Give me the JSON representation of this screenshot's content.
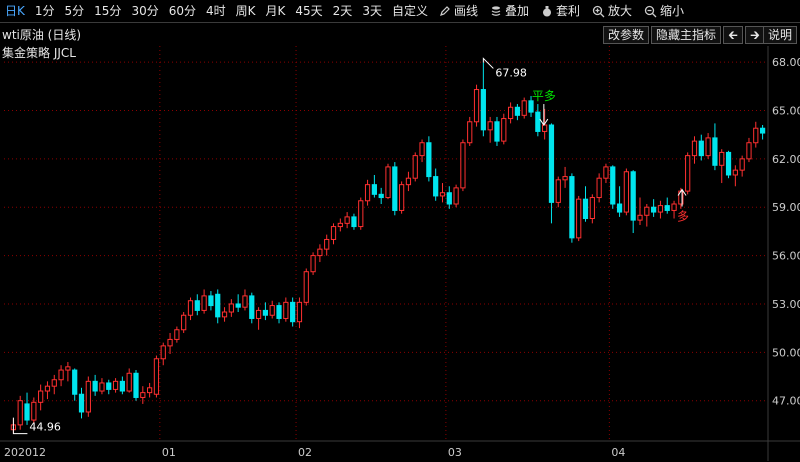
{
  "toolbar": {
    "periods": [
      "日K",
      "1分",
      "5分",
      "15分",
      "30分",
      "60分",
      "4时",
      "周K",
      "月K",
      "45天",
      "2天",
      "3天",
      "自定义"
    ],
    "active_period": "日K",
    "tools": [
      {
        "label": "画线",
        "icon": "pencil-icon"
      },
      {
        "label": "叠加",
        "icon": "stack-icon"
      },
      {
        "label": "套利",
        "icon": "money-bag-icon"
      },
      {
        "label": "放大",
        "icon": "zoom-in-icon"
      },
      {
        "label": "缩小",
        "icon": "zoom-out-icon"
      }
    ]
  },
  "chart_header": {
    "title": "wti原油 (日线)",
    "strategy": "集金策略 JJCL",
    "buttons": {
      "params": "改参数",
      "hide_main": "隐藏主指标",
      "help": "说明"
    }
  },
  "colors": {
    "up": "#ff3030",
    "down": "#00e5ee",
    "grid": "#8b0000",
    "axis": "#3a3a3a",
    "signal_green": "#00e000",
    "signal_red": "#ff3030"
  },
  "chart_data": {
    "type": "candlestick",
    "instrument": "wti原油",
    "period": "日线",
    "ylim": [
      44.5,
      69.0
    ],
    "yticks": [
      "68.00",
      "65.00",
      "62.00",
      "59.00",
      "56.00",
      "53.00",
      "50.00",
      "47.00"
    ],
    "ytick_values": [
      68,
      65,
      62,
      59,
      56,
      53,
      50,
      47
    ],
    "xticks": [
      "202012",
      "01",
      "02",
      "03",
      "04"
    ],
    "xtick_index": [
      0,
      22,
      42,
      64,
      88
    ],
    "candles": [
      {
        "o": 45.2,
        "h": 45.9,
        "l": 44.96,
        "c": 45.5
      },
      {
        "o": 45.5,
        "h": 47.3,
        "l": 45.2,
        "c": 47.0
      },
      {
        "o": 46.8,
        "h": 47.5,
        "l": 45.5,
        "c": 45.8
      },
      {
        "o": 45.8,
        "h": 47.2,
        "l": 45.6,
        "c": 46.9
      },
      {
        "o": 46.9,
        "h": 48.0,
        "l": 46.4,
        "c": 47.6
      },
      {
        "o": 47.6,
        "h": 48.2,
        "l": 47.1,
        "c": 47.9
      },
      {
        "o": 47.9,
        "h": 48.6,
        "l": 47.4,
        "c": 48.3
      },
      {
        "o": 48.3,
        "h": 49.2,
        "l": 47.9,
        "c": 48.9
      },
      {
        "o": 48.9,
        "h": 49.4,
        "l": 48.2,
        "c": 49.1
      },
      {
        "o": 48.9,
        "h": 49.0,
        "l": 47.0,
        "c": 47.4
      },
      {
        "o": 47.4,
        "h": 47.8,
        "l": 45.9,
        "c": 46.3
      },
      {
        "o": 46.3,
        "h": 48.5,
        "l": 46.0,
        "c": 48.2
      },
      {
        "o": 48.2,
        "h": 48.6,
        "l": 47.3,
        "c": 47.6
      },
      {
        "o": 47.6,
        "h": 48.4,
        "l": 47.4,
        "c": 48.1
      },
      {
        "o": 48.1,
        "h": 48.3,
        "l": 47.4,
        "c": 47.7
      },
      {
        "o": 47.7,
        "h": 48.4,
        "l": 47.5,
        "c": 48.2
      },
      {
        "o": 48.2,
        "h": 48.5,
        "l": 47.4,
        "c": 47.6
      },
      {
        "o": 47.6,
        "h": 49.0,
        "l": 47.5,
        "c": 48.7
      },
      {
        "o": 48.7,
        "h": 48.9,
        "l": 47.0,
        "c": 47.2
      },
      {
        "o": 47.2,
        "h": 47.9,
        "l": 46.8,
        "c": 47.5
      },
      {
        "o": 47.5,
        "h": 48.1,
        "l": 47.2,
        "c": 47.8
      },
      {
        "o": 47.4,
        "h": 49.8,
        "l": 47.2,
        "c": 49.6
      },
      {
        "o": 49.6,
        "h": 50.6,
        "l": 49.2,
        "c": 50.4
      },
      {
        "o": 50.4,
        "h": 51.2,
        "l": 49.9,
        "c": 50.8
      },
      {
        "o": 50.8,
        "h": 51.6,
        "l": 50.6,
        "c": 51.4
      },
      {
        "o": 51.4,
        "h": 52.5,
        "l": 51.2,
        "c": 52.3
      },
      {
        "o": 52.3,
        "h": 53.4,
        "l": 52.0,
        "c": 53.2
      },
      {
        "o": 53.2,
        "h": 53.6,
        "l": 52.3,
        "c": 52.6
      },
      {
        "o": 52.6,
        "h": 53.9,
        "l": 52.4,
        "c": 53.5
      },
      {
        "o": 53.5,
        "h": 53.8,
        "l": 52.6,
        "c": 52.9
      },
      {
        "o": 53.6,
        "h": 53.9,
        "l": 51.8,
        "c": 52.2
      },
      {
        "o": 52.2,
        "h": 52.8,
        "l": 51.9,
        "c": 52.5
      },
      {
        "o": 52.5,
        "h": 53.3,
        "l": 52.2,
        "c": 53.0
      },
      {
        "o": 53.0,
        "h": 53.6,
        "l": 52.5,
        "c": 52.8
      },
      {
        "o": 52.8,
        "h": 53.9,
        "l": 52.6,
        "c": 53.5
      },
      {
        "o": 53.5,
        "h": 53.7,
        "l": 51.8,
        "c": 52.1
      },
      {
        "o": 52.1,
        "h": 52.8,
        "l": 51.4,
        "c": 52.6
      },
      {
        "o": 52.6,
        "h": 53.1,
        "l": 52.0,
        "c": 52.3
      },
      {
        "o": 52.3,
        "h": 53.2,
        "l": 52.1,
        "c": 52.9
      },
      {
        "o": 52.9,
        "h": 53.1,
        "l": 51.8,
        "c": 52.1
      },
      {
        "o": 52.1,
        "h": 53.4,
        "l": 51.9,
        "c": 53.1
      },
      {
        "o": 53.1,
        "h": 53.4,
        "l": 51.6,
        "c": 51.9
      },
      {
        "o": 51.9,
        "h": 53.4,
        "l": 51.5,
        "c": 53.1
      },
      {
        "o": 53.1,
        "h": 55.2,
        "l": 52.9,
        "c": 55.0
      },
      {
        "o": 55.0,
        "h": 56.2,
        "l": 54.8,
        "c": 56.0
      },
      {
        "o": 56.0,
        "h": 56.7,
        "l": 55.6,
        "c": 56.4
      },
      {
        "o": 56.4,
        "h": 57.3,
        "l": 56.0,
        "c": 57.0
      },
      {
        "o": 57.0,
        "h": 58.0,
        "l": 56.7,
        "c": 57.8
      },
      {
        "o": 57.8,
        "h": 58.3,
        "l": 57.5,
        "c": 58.0
      },
      {
        "o": 58.0,
        "h": 58.7,
        "l": 57.7,
        "c": 58.4
      },
      {
        "o": 58.4,
        "h": 58.6,
        "l": 57.6,
        "c": 57.8
      },
      {
        "o": 57.8,
        "h": 59.6,
        "l": 57.6,
        "c": 59.4
      },
      {
        "o": 59.4,
        "h": 60.7,
        "l": 59.1,
        "c": 60.4
      },
      {
        "o": 60.4,
        "h": 61.0,
        "l": 59.6,
        "c": 59.8
      },
      {
        "o": 59.8,
        "h": 60.2,
        "l": 59.2,
        "c": 59.6
      },
      {
        "o": 59.6,
        "h": 61.7,
        "l": 59.5,
        "c": 61.5
      },
      {
        "o": 61.5,
        "h": 61.8,
        "l": 58.5,
        "c": 58.8
      },
      {
        "o": 58.8,
        "h": 60.6,
        "l": 58.6,
        "c": 60.4
      },
      {
        "o": 60.4,
        "h": 61.2,
        "l": 60.0,
        "c": 60.8
      },
      {
        "o": 60.8,
        "h": 62.4,
        "l": 60.6,
        "c": 62.2
      },
      {
        "o": 62.2,
        "h": 63.2,
        "l": 61.8,
        "c": 63.0
      },
      {
        "o": 63.0,
        "h": 63.4,
        "l": 60.6,
        "c": 60.9
      },
      {
        "o": 60.9,
        "h": 61.4,
        "l": 59.4,
        "c": 59.7
      },
      {
        "o": 59.7,
        "h": 60.5,
        "l": 59.3,
        "c": 59.9
      },
      {
        "o": 59.9,
        "h": 60.3,
        "l": 58.9,
        "c": 59.2
      },
      {
        "o": 59.2,
        "h": 60.4,
        "l": 59.0,
        "c": 60.2
      },
      {
        "o": 60.2,
        "h": 63.2,
        "l": 60.0,
        "c": 63.0
      },
      {
        "o": 63.0,
        "h": 64.6,
        "l": 62.8,
        "c": 64.3
      },
      {
        "o": 64.3,
        "h": 66.6,
        "l": 64.0,
        "c": 66.3
      },
      {
        "o": 66.3,
        "h": 67.98,
        "l": 63.4,
        "c": 63.8
      },
      {
        "o": 63.8,
        "h": 64.6,
        "l": 63.0,
        "c": 64.3
      },
      {
        "o": 64.3,
        "h": 64.6,
        "l": 62.8,
        "c": 63.1
      },
      {
        "o": 63.1,
        "h": 64.8,
        "l": 62.9,
        "c": 64.5
      },
      {
        "o": 64.5,
        "h": 65.5,
        "l": 64.2,
        "c": 65.2
      },
      {
        "o": 65.2,
        "h": 65.4,
        "l": 64.4,
        "c": 64.7
      },
      {
        "o": 64.7,
        "h": 65.8,
        "l": 64.5,
        "c": 65.6
      },
      {
        "o": 65.6,
        "h": 65.9,
        "l": 64.6,
        "c": 64.9
      },
      {
        "o": 64.9,
        "h": 65.4,
        "l": 63.4,
        "c": 63.7
      },
      {
        "o": 63.7,
        "h": 65.1,
        "l": 63.2,
        "c": 64.1
      },
      {
        "o": 64.1,
        "h": 64.2,
        "l": 58.0,
        "c": 59.3
      },
      {
        "o": 59.3,
        "h": 60.9,
        "l": 59.0,
        "c": 60.7
      },
      {
        "o": 60.7,
        "h": 61.5,
        "l": 60.2,
        "c": 60.9
      },
      {
        "o": 60.9,
        "h": 61.1,
        "l": 56.8,
        "c": 57.1
      },
      {
        "o": 57.1,
        "h": 59.7,
        "l": 56.9,
        "c": 59.5
      },
      {
        "o": 59.5,
        "h": 60.3,
        "l": 58.1,
        "c": 58.3
      },
      {
        "o": 58.3,
        "h": 59.8,
        "l": 58.0,
        "c": 59.6
      },
      {
        "o": 59.6,
        "h": 61.1,
        "l": 59.3,
        "c": 60.8
      },
      {
        "o": 60.8,
        "h": 61.7,
        "l": 60.5,
        "c": 61.5
      },
      {
        "o": 61.5,
        "h": 61.6,
        "l": 58.9,
        "c": 59.2
      },
      {
        "o": 59.2,
        "h": 60.3,
        "l": 58.4,
        "c": 58.7
      },
      {
        "o": 58.7,
        "h": 61.4,
        "l": 58.5,
        "c": 61.2
      },
      {
        "o": 61.2,
        "h": 61.3,
        "l": 57.4,
        "c": 58.2
      },
      {
        "o": 58.2,
        "h": 59.6,
        "l": 57.9,
        "c": 58.5
      },
      {
        "o": 58.5,
        "h": 59.2,
        "l": 57.8,
        "c": 59.0
      },
      {
        "o": 59.0,
        "h": 59.5,
        "l": 58.4,
        "c": 58.7
      },
      {
        "o": 58.7,
        "h": 59.4,
        "l": 58.3,
        "c": 59.1
      },
      {
        "o": 59.1,
        "h": 59.6,
        "l": 58.6,
        "c": 58.8
      },
      {
        "o": 58.8,
        "h": 59.4,
        "l": 58.3,
        "c": 59.2
      },
      {
        "o": 59.2,
        "h": 60.2,
        "l": 58.9,
        "c": 60.0
      },
      {
        "o": 60.0,
        "h": 62.4,
        "l": 59.8,
        "c": 62.2
      },
      {
        "o": 62.2,
        "h": 63.4,
        "l": 61.7,
        "c": 63.1
      },
      {
        "o": 63.1,
        "h": 63.5,
        "l": 61.9,
        "c": 62.2
      },
      {
        "o": 62.2,
        "h": 63.6,
        "l": 62.0,
        "c": 63.3
      },
      {
        "o": 63.3,
        "h": 64.2,
        "l": 61.3,
        "c": 61.6
      },
      {
        "o": 61.6,
        "h": 62.6,
        "l": 60.5,
        "c": 62.4
      },
      {
        "o": 62.4,
        "h": 62.5,
        "l": 60.8,
        "c": 61.0
      },
      {
        "o": 61.0,
        "h": 61.6,
        "l": 60.3,
        "c": 61.3
      },
      {
        "o": 61.3,
        "h": 62.2,
        "l": 60.9,
        "c": 62.0
      },
      {
        "o": 62.0,
        "h": 63.3,
        "l": 61.8,
        "c": 63.0
      },
      {
        "o": 63.0,
        "h": 64.3,
        "l": 62.7,
        "c": 63.9
      },
      {
        "o": 63.9,
        "h": 64.1,
        "l": 63.2,
        "c": 63.6
      }
    ],
    "annotations": [
      {
        "text": "67.98",
        "type": "high"
      },
      {
        "text": "44.96",
        "type": "low"
      },
      {
        "text": "平多",
        "type": "exit-long",
        "candle": 77
      },
      {
        "text": "多",
        "type": "enter-long",
        "candle": 97
      }
    ]
  }
}
